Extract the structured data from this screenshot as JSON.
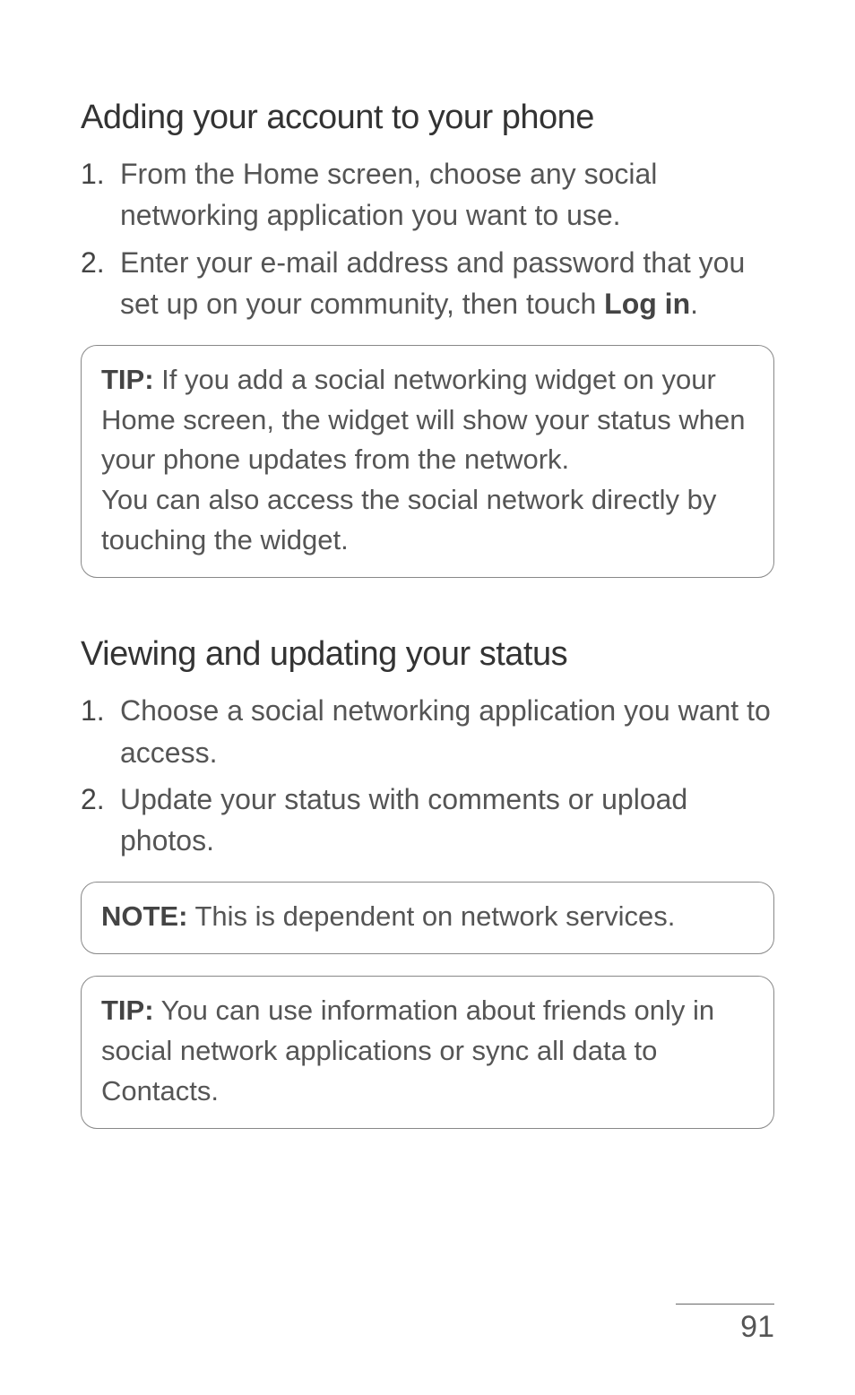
{
  "section1": {
    "heading": "Adding your account to your phone",
    "steps": [
      {
        "num": "1.",
        "text": "From the Home screen, choose any social networking application you want to use."
      },
      {
        "num": "2.",
        "text_before": "Enter your e-mail address and password that you set up on your community, then touch ",
        "bold": "Log in",
        "text_after": "."
      }
    ],
    "tip": {
      "label": "TIP:",
      "p1": " If you add a social networking widget on your Home screen, the widget will show your status when your phone updates from the network.",
      "p2": "You can also access the social network directly by touching the widget."
    }
  },
  "section2": {
    "heading": "Viewing and updating your status",
    "steps": [
      {
        "num": "1.",
        "text": "Choose a social networking application you want to access."
      },
      {
        "num": "2.",
        "text": "Update your status with comments or upload photos."
      }
    ],
    "note": {
      "label": "NOTE:",
      "text": " This is dependent on network services."
    },
    "tip": {
      "label": "TIP:",
      "text": " You can use information about friends only in social network applications or sync all data to Contacts."
    }
  },
  "page_number": "91"
}
